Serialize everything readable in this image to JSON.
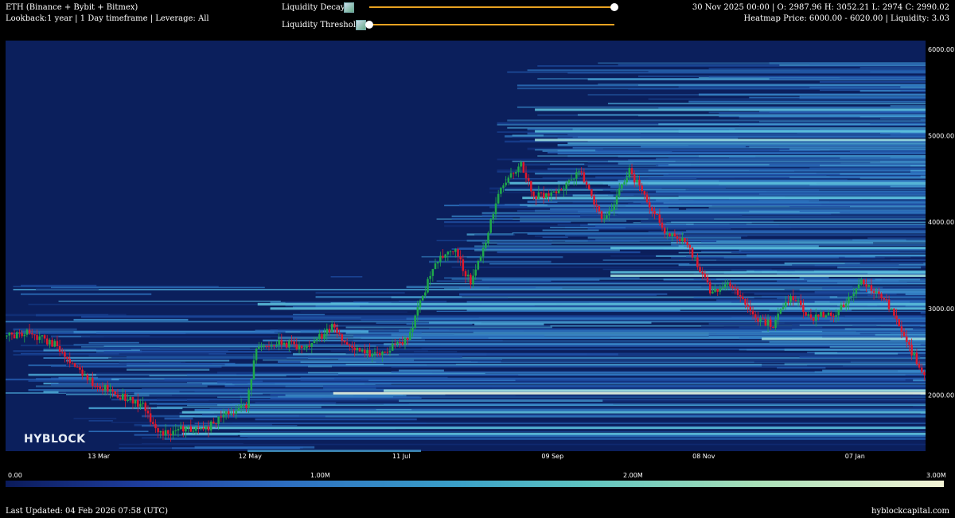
{
  "header": {
    "title": "ETH (Binance + Bybit + Bitmex)",
    "subtitle": "Lookback:1 year | 1 Day timeframe | Leverage: All",
    "ohlc": "30 Nov 2025 00:00 | O: 2987.96 H: 3052.21 L: 2974 C: 2990.02",
    "heatmap_info": "Heatmap Price: 6000.00 - 6020.00 | Liquidity: 3.03"
  },
  "controls": {
    "decay_label": "Liquidity Decay",
    "threshold_label": "Liquidity Threshold",
    "decay_value": 1.0,
    "threshold_value": 0.0
  },
  "logo": "HYBLOCK",
  "colorbar": {
    "labels": [
      "0.00",
      "1.00M",
      "2.00M",
      "3.00M"
    ],
    "values": [
      0,
      1000000,
      2000000,
      3000000
    ]
  },
  "footer": {
    "updated": "Last Updated: 04 Feb 2026 07:58 (UTC)",
    "site": "hyblockcapital.com"
  },
  "colors": {
    "background": "#0b1f5c",
    "up": "#1fa84a",
    "down": "#e0182c",
    "slider": "#e8a221"
  },
  "chart_data": {
    "type": "heatmap",
    "ylim": [
      1350,
      6100
    ],
    "y_ticks": [
      2000,
      3000,
      4000,
      5000,
      6000
    ],
    "y_tick_labels": [
      "2000.00",
      "3000.00",
      "4000.00",
      "5000.00",
      "6000.00"
    ],
    "x_tick_labels": [
      "13 Mar",
      "12 May",
      "11 Jul",
      "09 Sep",
      "08 Nov",
      "07 Jan"
    ],
    "x_tick_days": [
      37,
      97,
      157,
      217,
      277,
      337
    ],
    "days": 365,
    "price_path": [
      [
        0,
        2680
      ],
      [
        10,
        2720
      ],
      [
        20,
        2580
      ],
      [
        35,
        2150
      ],
      [
        45,
        2000
      ],
      [
        55,
        1880
      ],
      [
        60,
        1600
      ],
      [
        65,
        1550
      ],
      [
        70,
        1620
      ],
      [
        80,
        1600
      ],
      [
        88,
        1800
      ],
      [
        96,
        1850
      ],
      [
        100,
        2550
      ],
      [
        110,
        2600
      ],
      [
        120,
        2550
      ],
      [
        130,
        2780
      ],
      [
        140,
        2500
      ],
      [
        148,
        2450
      ],
      [
        160,
        2650
      ],
      [
        165,
        3050
      ],
      [
        170,
        3500
      ],
      [
        178,
        3700
      ],
      [
        185,
        3300
      ],
      [
        190,
        3700
      ],
      [
        197,
        4400
      ],
      [
        205,
        4650
      ],
      [
        210,
        4300
      ],
      [
        220,
        4350
      ],
      [
        228,
        4600
      ],
      [
        238,
        4000
      ],
      [
        248,
        4600
      ],
      [
        255,
        4250
      ],
      [
        262,
        3900
      ],
      [
        270,
        3800
      ],
      [
        280,
        3200
      ],
      [
        288,
        3300
      ],
      [
        298,
        2900
      ],
      [
        305,
        2800
      ],
      [
        312,
        3150
      ],
      [
        320,
        2900
      ],
      [
        330,
        2950
      ],
      [
        340,
        3300
      ],
      [
        345,
        3200
      ],
      [
        352,
        3000
      ],
      [
        360,
        2500
      ],
      [
        365,
        2220
      ]
    ],
    "liquidity_bands": [
      {
        "price": 2020,
        "intensity": 0.95,
        "from_day": 130
      },
      {
        "price": 2050,
        "intensity": 0.8,
        "from_day": 150
      },
      {
        "price": 1800,
        "intensity": 0.55,
        "from_day": 70
      },
      {
        "price": 1550,
        "intensity": 0.6,
        "from_day": 70
      },
      {
        "price": 1620,
        "intensity": 0.5,
        "from_day": 70
      },
      {
        "price": 2650,
        "intensity": 0.85,
        "from_day": 300
      },
      {
        "price": 3000,
        "intensity": 0.6,
        "from_day": 105
      },
      {
        "price": 3050,
        "intensity": 0.55,
        "from_day": 100
      },
      {
        "price": 3380,
        "intensity": 0.75,
        "from_day": 240
      },
      {
        "price": 3420,
        "intensity": 0.7,
        "from_day": 240
      },
      {
        "price": 3700,
        "intensity": 0.55,
        "from_day": 240
      },
      {
        "price": 4280,
        "intensity": 0.55,
        "from_day": 205
      },
      {
        "price": 4950,
        "intensity": 0.8,
        "from_day": 210
      },
      {
        "price": 5050,
        "intensity": 0.7,
        "from_day": 210
      },
      {
        "price": 5300,
        "intensity": 0.6,
        "from_day": 210
      },
      {
        "price": 4450,
        "intensity": 0.6,
        "from_day": 200
      }
    ]
  }
}
